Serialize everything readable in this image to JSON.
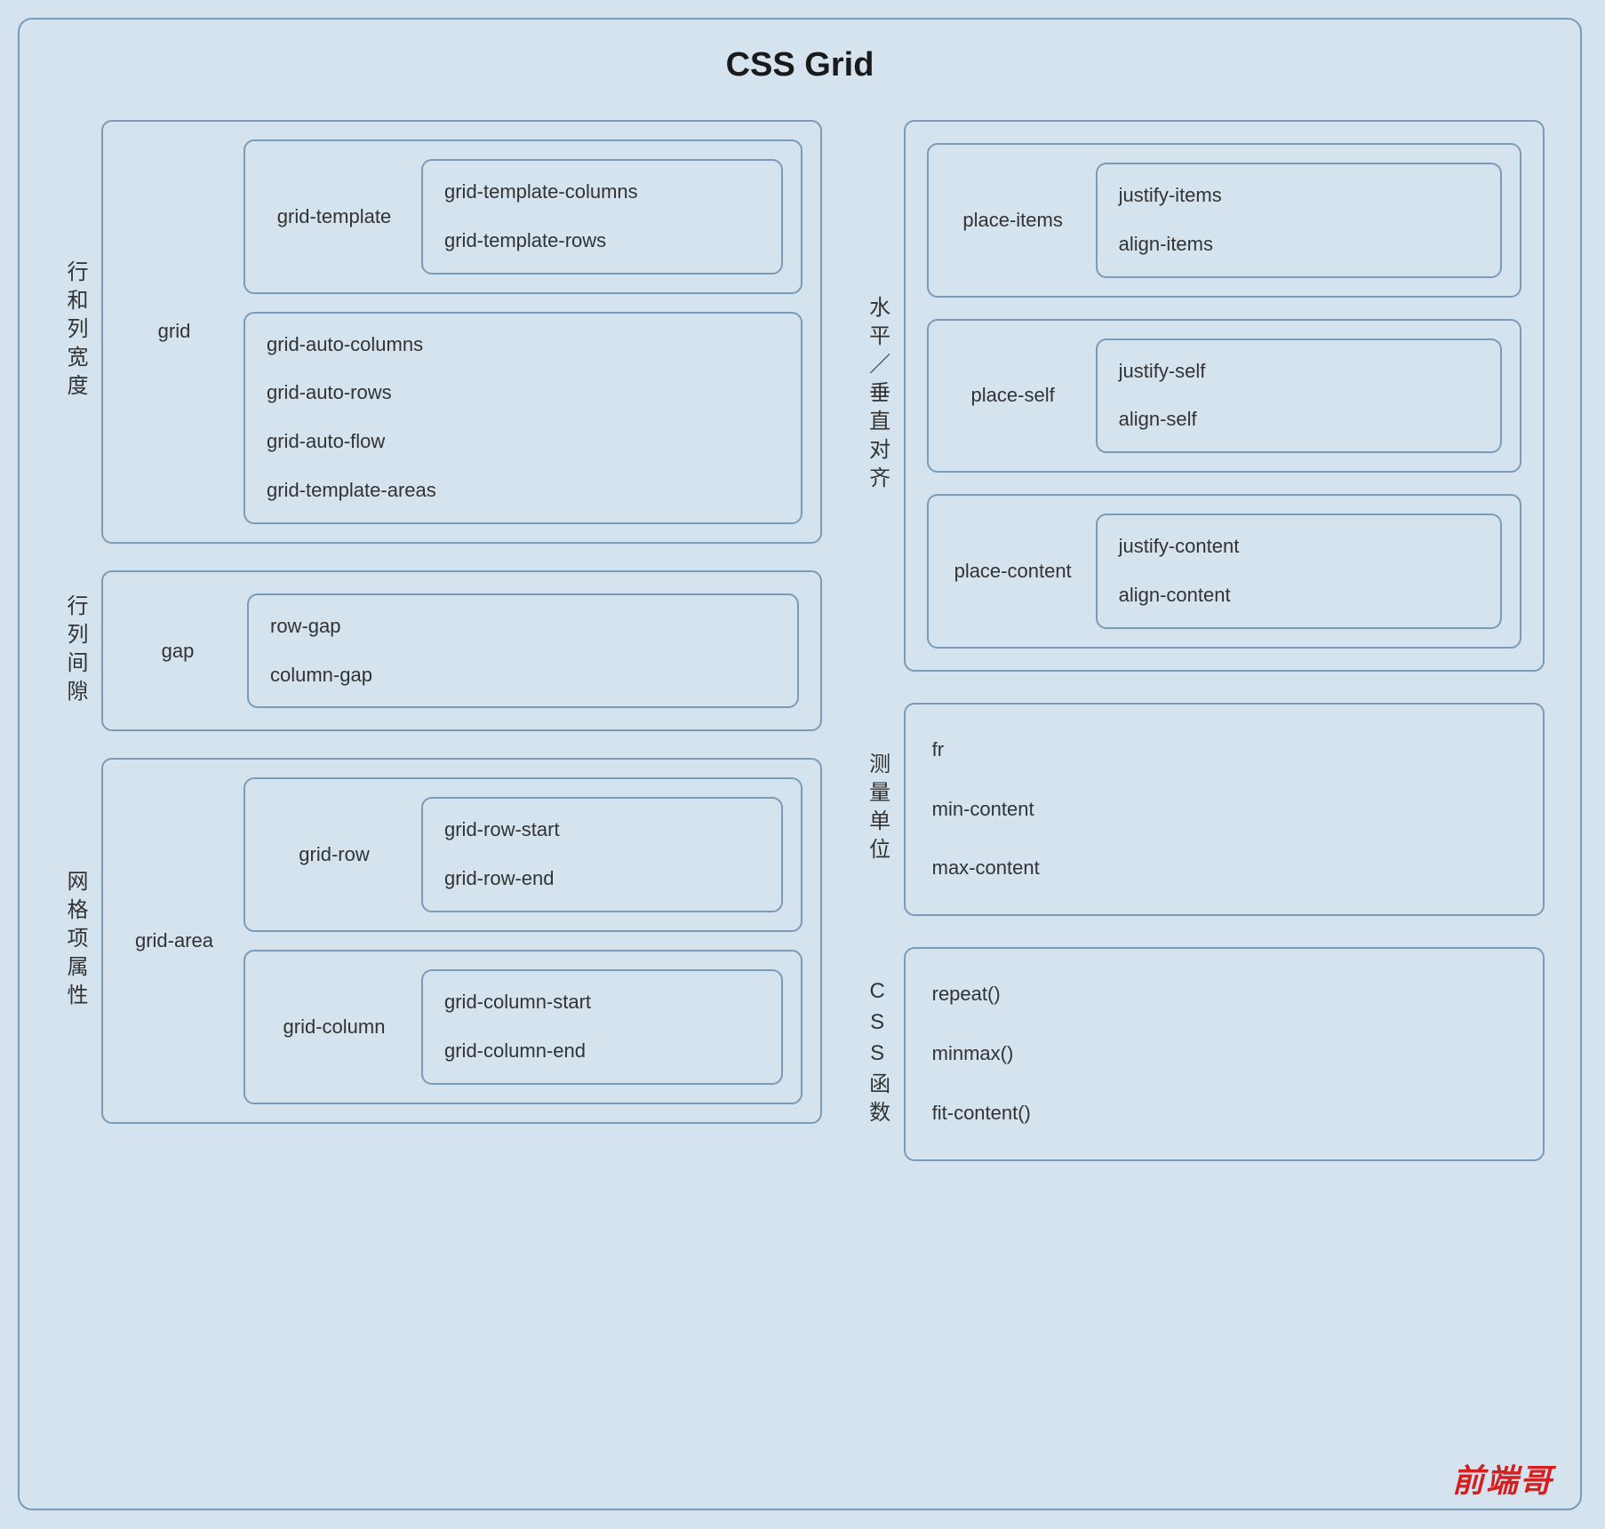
{
  "title": "CSS Grid",
  "sections": {
    "rowColWidth": {
      "label": "行和列宽度",
      "parent": "grid",
      "groups": [
        {
          "label": "grid-template",
          "items": [
            "grid-template-columns",
            "grid-template-rows"
          ]
        },
        {
          "label": null,
          "items": [
            "grid-auto-columns",
            "grid-auto-rows",
            "grid-auto-flow",
            "grid-template-areas"
          ]
        }
      ]
    },
    "rowColGap": {
      "label": "行列间隙",
      "parent": "gap",
      "items": [
        "row-gap",
        "column-gap"
      ]
    },
    "gridItem": {
      "label": "网格项属性",
      "parent": "grid-area",
      "groups": [
        {
          "label": "grid-row",
          "items": [
            "grid-row-start",
            "grid-row-end"
          ]
        },
        {
          "label": "grid-column",
          "items": [
            "grid-column-start",
            "grid-column-end"
          ]
        }
      ]
    },
    "alignment": {
      "label": "水平／垂直对齐",
      "groups": [
        {
          "label": "place-items",
          "items": [
            "justify-items",
            "align-items"
          ]
        },
        {
          "label": "place-self",
          "items": [
            "justify-self",
            "align-self"
          ]
        },
        {
          "label": "place-content",
          "items": [
            "justify-content",
            "align-content"
          ]
        }
      ]
    },
    "units": {
      "label": "测量单位",
      "items": [
        "fr",
        "min-content",
        "max-content"
      ]
    },
    "functions": {
      "label": "CSS函数",
      "items": [
        "repeat()",
        "minmax()",
        "fit-content()"
      ]
    }
  },
  "watermark": "前端哥"
}
